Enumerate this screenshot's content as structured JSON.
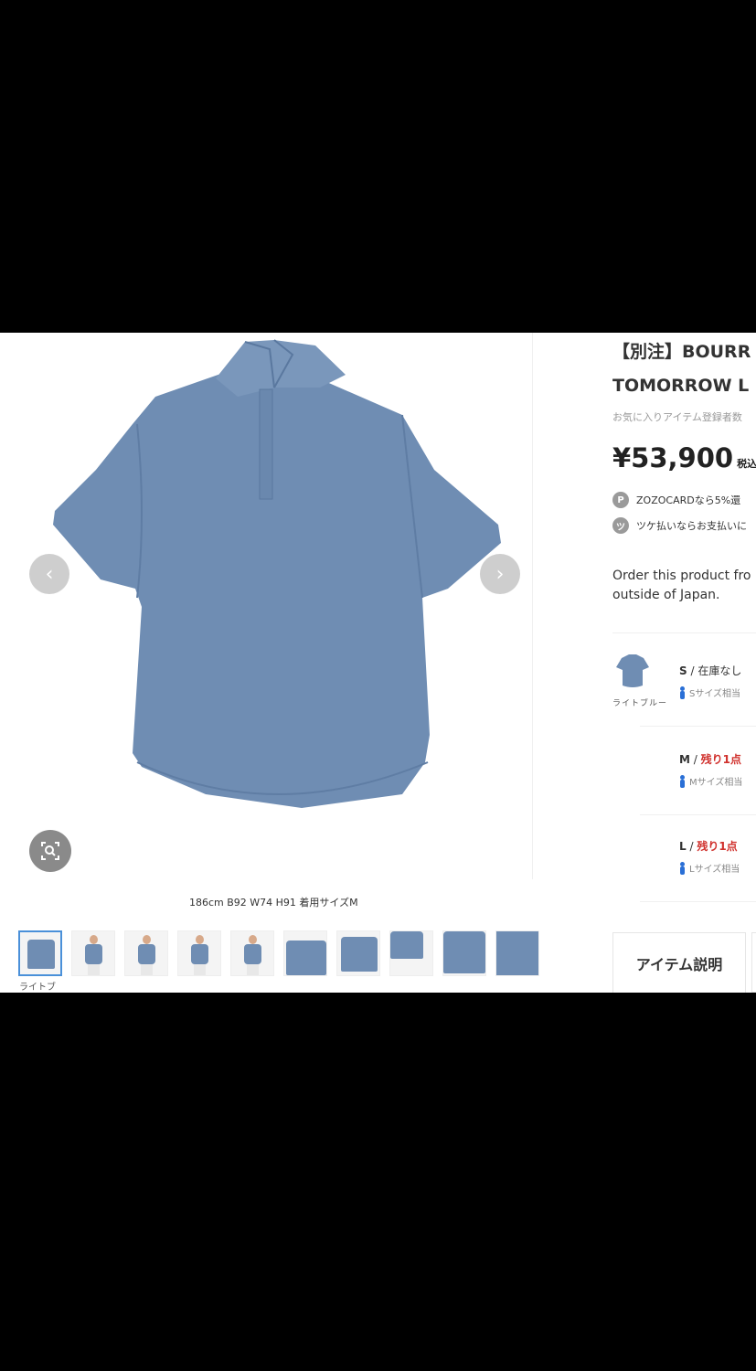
{
  "product": {
    "title_line1": "【別注】BOURR",
    "title_line2": "TOMORROW L",
    "favorites_text": "お気に入りアイテム登録者数",
    "price": "¥53,900",
    "tax_label": "税込",
    "zozocard_text": "ZOZOCARDなら5%還",
    "tsuke_text": "ツケ払いならお支払いに",
    "order_line1": "Order this product fro",
    "order_line2": "outside of Japan."
  },
  "badges": {
    "p": "P",
    "tsuke": "ツ"
  },
  "gallery": {
    "prev_label": "‹",
    "next_label": "›",
    "caption": "186cm B92 W74 H91 着用サイズM",
    "thumb_label": "ライトブ",
    "thumb_count": 10
  },
  "color": {
    "name": "ライトブルー",
    "swatch": "#6f8db3"
  },
  "sizes": [
    {
      "size": "S",
      "sep": " / ",
      "stock": "在庫なし",
      "stock_red": false,
      "note": "Sサイズ相当"
    },
    {
      "size": "M",
      "sep": " / ",
      "stock": "残り1点",
      "stock_red": true,
      "note": "Mサイズ相当"
    },
    {
      "size": "L",
      "sep": " / ",
      "stock": "残り1点",
      "stock_red": true,
      "note": "Lサイズ相当"
    }
  ],
  "tabs": {
    "item_description": "アイテム説明"
  },
  "icons": {
    "zoom": "zoom-icon",
    "prev": "chevron-left-icon",
    "next": "chevron-right-icon"
  }
}
